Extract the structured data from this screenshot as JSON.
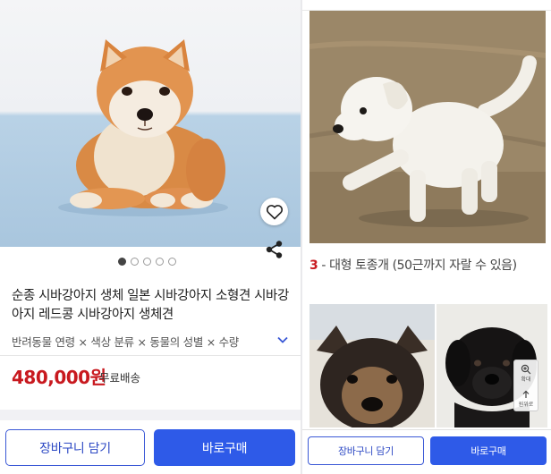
{
  "left": {
    "carousel": {
      "count": 5,
      "active": 0
    },
    "title": "순종 시바강아지 생체 일본 시바강아지 소형견 시바강아지 레드콩 시바강아지 생체견",
    "options": "반려동물 연령 × 색상 분류 × 동물의 성별 × 수량",
    "price": "480,000원",
    "shipping": "무료배송",
    "cart_label": "장바구니 담기",
    "buy_label": "바로구매",
    "icons": [
      "heart-icon",
      "share-icon",
      "chevron-down-icon"
    ]
  },
  "right": {
    "caption_num": "3",
    "caption_text": " - 대형 토종개 (50근까지 자랄 수 있음)",
    "zoom_in_label": "확대",
    "reset_label": "원위로",
    "cart_label": "장바구니 담기",
    "buy_label": "바로구매"
  },
  "colors": {
    "accent_blue": "#2e5ae8",
    "price_red": "#c8191f"
  }
}
